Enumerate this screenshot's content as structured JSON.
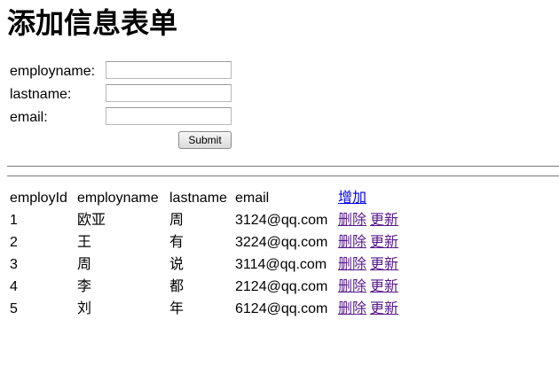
{
  "page": {
    "title": "添加信息表单"
  },
  "form": {
    "fields": [
      {
        "label": "employname:",
        "value": ""
      },
      {
        "label": "lastname:",
        "value": ""
      },
      {
        "label": "email:",
        "value": ""
      }
    ],
    "submit_label": "Submit"
  },
  "table": {
    "headers": [
      "employId",
      "employname",
      "lastname",
      "email"
    ],
    "add_link": "增加",
    "delete_label": "删除",
    "update_label": "更新",
    "rows": [
      {
        "id": "1",
        "employname": "欧亚",
        "lastname": "周",
        "email": "3124@qq.com"
      },
      {
        "id": "2",
        "employname": "王",
        "lastname": "有",
        "email": "3224@qq.com"
      },
      {
        "id": "3",
        "employname": "周",
        "lastname": "说",
        "email": "3114@qq.com"
      },
      {
        "id": "4",
        "employname": "李",
        "lastname": "都",
        "email": "2124@qq.com"
      },
      {
        "id": "5",
        "employname": "刘",
        "lastname": "年",
        "email": "6124@qq.com"
      }
    ]
  },
  "colors": {
    "link": "#0000ee",
    "visited_link": "#551a8b"
  }
}
